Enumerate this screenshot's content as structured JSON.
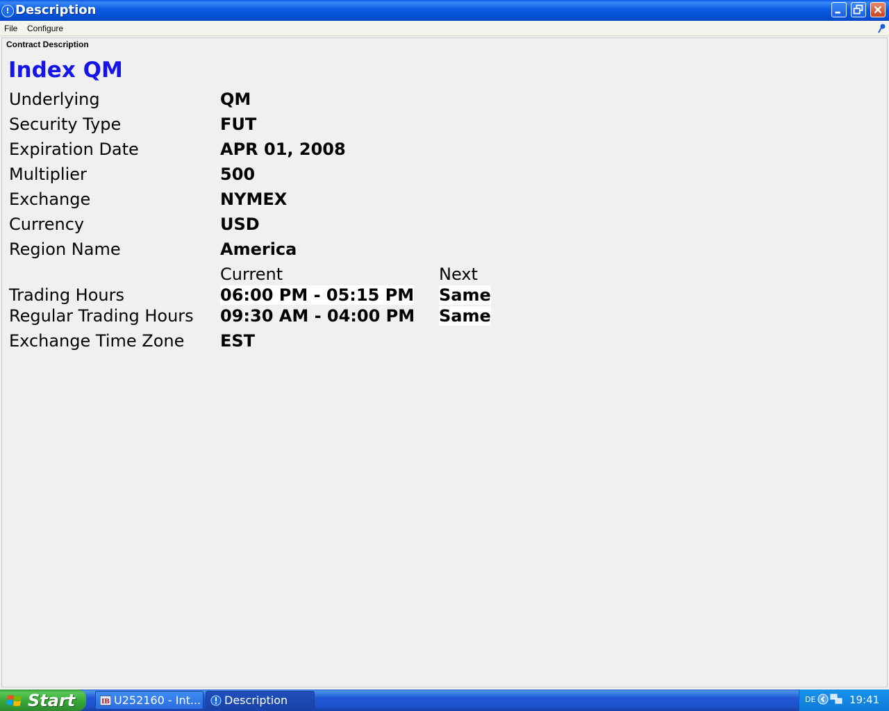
{
  "window": {
    "title": "Description"
  },
  "menu": {
    "file": "File",
    "configure": "Configure"
  },
  "panel": {
    "label": "Contract Description"
  },
  "contract": {
    "title": "Index QM",
    "rows": [
      {
        "label": "Underlying",
        "value": "QM"
      },
      {
        "label": "Security Type",
        "value": "FUT"
      },
      {
        "label": "Expiration Date",
        "value": "APR 01, 2008"
      },
      {
        "label": "Multiplier",
        "value": "500"
      },
      {
        "label": "Exchange",
        "value": "NYMEX"
      },
      {
        "label": "Currency",
        "value": "USD"
      },
      {
        "label": "Region Name",
        "value": "America"
      }
    ],
    "hours_header": {
      "current": "Current",
      "next": "Next"
    },
    "trading_hours": {
      "label": "Trading Hours",
      "current": "06:00 PM - 05:15 PM",
      "next": "Same"
    },
    "regular_hours": {
      "label": "Regular Trading Hours",
      "current": "09:30 AM - 04:00 PM",
      "next": "Same"
    },
    "time_zone": {
      "label": "Exchange Time Zone",
      "value": "EST"
    }
  },
  "taskbar": {
    "start": "Start",
    "tasks": [
      {
        "label": "U252160 - Int...",
        "icon": "ib-icon"
      },
      {
        "label": "Description",
        "icon": "info-icon"
      }
    ],
    "tray": {
      "lang": "DE",
      "clock": "19:41"
    }
  },
  "colors": {
    "title_blue": "#1515e8",
    "titlebar": "#0a5be2",
    "highlight": "#ffffff"
  }
}
